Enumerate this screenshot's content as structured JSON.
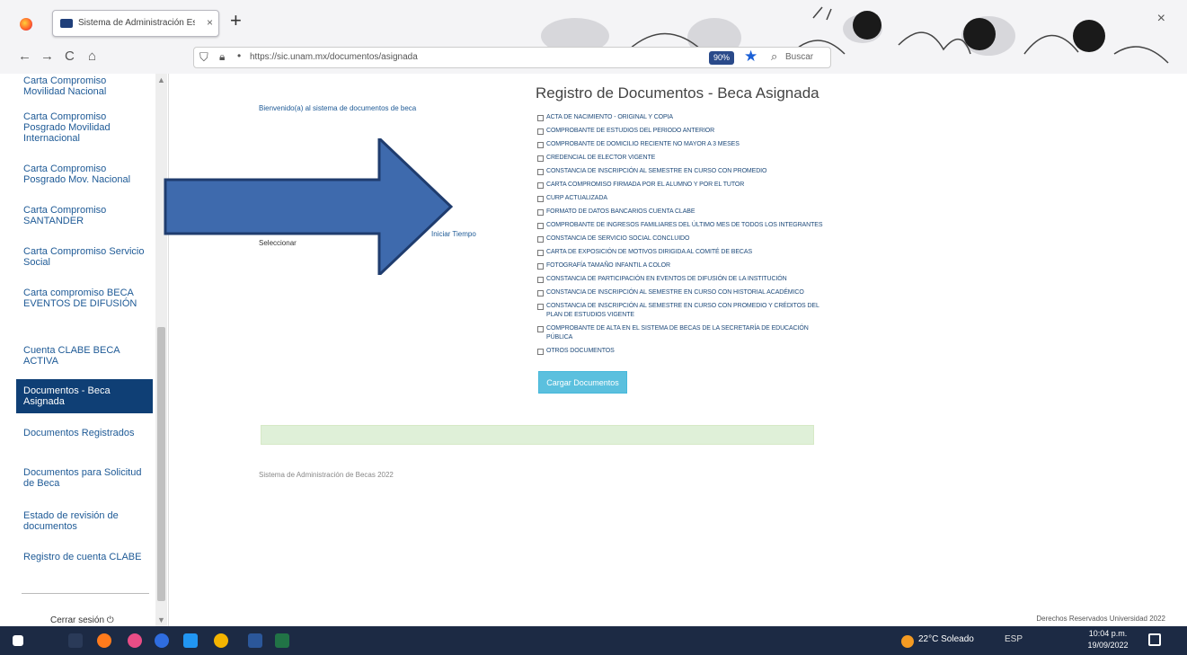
{
  "browser": {
    "tab_title": "Sistema de Administración Es...",
    "tab_close": "×",
    "new_tab": "+",
    "window_close": "×",
    "url": "https://sic.unam.mx/documentos/asignada",
    "zoom": "90%",
    "search_placeholder": "Buscar",
    "back": "←",
    "forward": "→",
    "reload": "C",
    "home": "⌂"
  },
  "sidebar": {
    "items": [
      {
        "label": "Carta Compromiso Movilidad Nacional"
      },
      {
        "label": "Carta Compromiso Posgrado Movilidad Internacional"
      },
      {
        "label": "Carta Compromiso Posgrado Mov. Nacional"
      },
      {
        "label": "Carta Compromiso SANTANDER"
      },
      {
        "label": "Carta Compromiso Servicio Social"
      },
      {
        "label": "Carta compromiso BECA EVENTOS DE DIFUSIÓN"
      },
      {
        "label": "Cuenta CLABE BECA ACTIVA"
      },
      {
        "label": "Documentos - Beca Asignada"
      },
      {
        "label": "Documentos Registrados"
      },
      {
        "label": "Documentos para Solicitud de Beca"
      },
      {
        "label": "Estado de revisión de documentos"
      },
      {
        "label": "Registro de cuenta CLABE"
      }
    ],
    "footer": "Cerrar sesión ⏻"
  },
  "main": {
    "left_text": "Bienvenido(a) al sistema de documentos de beca",
    "partial_right": "Iniciar Tiempo",
    "partial_left": "Seleccionar",
    "title": "Registro de Documentos - Beca Asignada",
    "checklist": [
      "ACTA DE NACIMIENTO - ORIGINAL Y COPIA",
      "COMPROBANTE DE ESTUDIOS DEL PERIODO ANTERIOR",
      "COMPROBANTE DE DOMICILIO RECIENTE NO MAYOR A 3 MESES",
      "CREDENCIAL DE ELECTOR VIGENTE",
      "CONSTANCIA DE INSCRIPCIÓN AL SEMESTRE EN CURSO CON PROMEDIO",
      "CARTA COMPROMISO FIRMADA POR EL ALUMNO Y POR EL TUTOR",
      "CURP ACTUALIZADA",
      "FORMATO DE DATOS BANCARIOS CUENTA CLABE",
      "COMPROBANTE DE INGRESOS FAMILIARES DEL ÚLTIMO MES DE TODOS LOS INTEGRANTES",
      "CONSTANCIA DE SERVICIO SOCIAL CONCLUIDO",
      "CARTA DE EXPOSICIÓN DE MOTIVOS DIRIGIDA AL COMITÉ DE BECAS",
      "FOTOGRAFÍA TAMAÑO INFANTIL A COLOR",
      "CONSTANCIA DE PARTICIPACIÓN EN EVENTOS DE DIFUSIÓN DE LA INSTITUCIÓN",
      "CONSTANCIA DE INSCRIPCIÓN AL SEMESTRE EN CURSO CON HISTORIAL ACADÉMICO",
      "CONSTANCIA DE INSCRIPCIÓN AL SEMESTRE EN CURSO CON PROMEDIO Y CRÉDITOS DEL PLAN DE ESTUDIOS VIGENTE",
      "COMPROBANTE DE ALTA EN EL SISTEMA DE BECAS DE LA SECRETARÍA DE EDUCACIÓN PÚBLICA",
      "OTROS DOCUMENTOS"
    ],
    "upload_label": "Cargar Documentos",
    "footer_text": "Sistema de Administración de Becas 2022",
    "copyright": "Derechos Reservados Universidad 2022"
  },
  "taskbar": {
    "weather": "22°C  Soleado",
    "tray": "ESP",
    "time": "10:04 p.m.",
    "date": "19/09/2022"
  },
  "colors": {
    "sidebar_active": "#0f3f75",
    "link": "#1e5a96",
    "upload_button": "#5bc0de",
    "success_bar": "#dff0d8",
    "arrow_fill": "#3e6aad",
    "arrow_stroke": "#1f3c6e",
    "taskbar": "#1c2a44"
  }
}
